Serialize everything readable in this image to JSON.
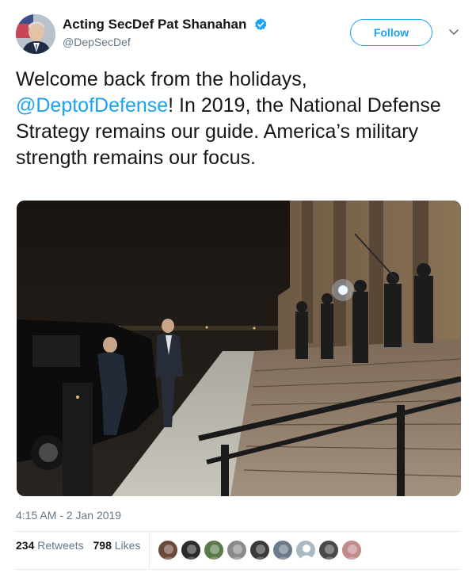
{
  "author": {
    "display_name": "Acting SecDef Pat Shanahan",
    "handle": "@DepSecDef",
    "verified": true,
    "avatar_icon": "profile-photo"
  },
  "follow_label": "Follow",
  "tweet": {
    "text_before": "Welcome back from the holidays, ",
    "mention": "@DeptofDefense",
    "text_after": "! In 2019, the National Defense Strategy remains our guide. America’s military strength remains our focus."
  },
  "timestamp": "4:15 AM - 2 Jan 2019",
  "stats": {
    "retweets_count": "234",
    "retweets_label": "Retweets",
    "likes_count": "798",
    "likes_label": "Likes"
  },
  "likers": [
    {
      "icon": "avatar-icon",
      "color": "#6b4a3a"
    },
    {
      "icon": "avatar-icon",
      "color": "#2b2b2b"
    },
    {
      "icon": "avatar-icon",
      "color": "#5a7a4a"
    },
    {
      "icon": "avatar-icon",
      "color": "#8a8a8a"
    },
    {
      "icon": "avatar-icon",
      "color": "#3a3a3a"
    },
    {
      "icon": "avatar-icon",
      "color": "#6b7a8a"
    },
    {
      "icon": "default-avatar-icon",
      "color": "#aab8c2"
    },
    {
      "icon": "avatar-icon",
      "color": "#4a4a4a"
    },
    {
      "icon": "avatar-icon",
      "color": "#c48a8a"
    }
  ],
  "colors": {
    "accent": "#1da1f2",
    "text": "#14171a",
    "secondary": "#657786"
  }
}
